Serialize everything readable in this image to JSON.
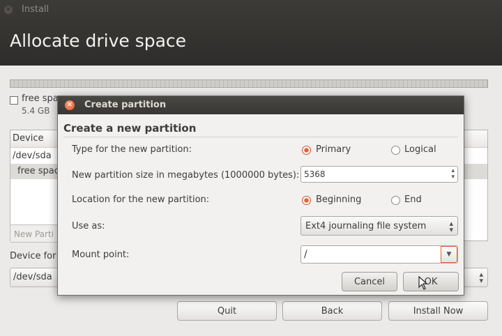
{
  "window": {
    "title": "Install",
    "close_icon": "close-icon"
  },
  "page": {
    "heading": "Allocate drive space"
  },
  "legend": {
    "label": "free spa",
    "size": "5.4 GB"
  },
  "table": {
    "columns": [
      "Device"
    ],
    "rows": [
      {
        "device": "/dev/sda"
      },
      {
        "device": "free spac"
      }
    ]
  },
  "buttons": {
    "new_partition": "New Parti",
    "quit": "Quit",
    "back": "Back",
    "install_now": "Install Now"
  },
  "bootloader": {
    "label": "Device for",
    "value": "/dev/sda"
  },
  "dialog": {
    "title": "Create partition",
    "heading": "Create a new partition",
    "type_label": "Type for the new partition:",
    "type_options": [
      "Primary",
      "Logical"
    ],
    "type_selected": "Primary",
    "size_label": "New partition size in megabytes (1000000 bytes):",
    "size_value": "5368",
    "location_label": "Location for the new partition:",
    "location_options": [
      "Beginning",
      "End"
    ],
    "location_selected": "Beginning",
    "use_as_label": "Use as:",
    "use_as_value": "Ext4 journaling file system",
    "mount_label": "Mount point:",
    "mount_value": "/",
    "cancel": "Cancel",
    "ok": "OK"
  },
  "colors": {
    "accent": "#e05a2a",
    "header_bg": "#2f2d2b"
  }
}
